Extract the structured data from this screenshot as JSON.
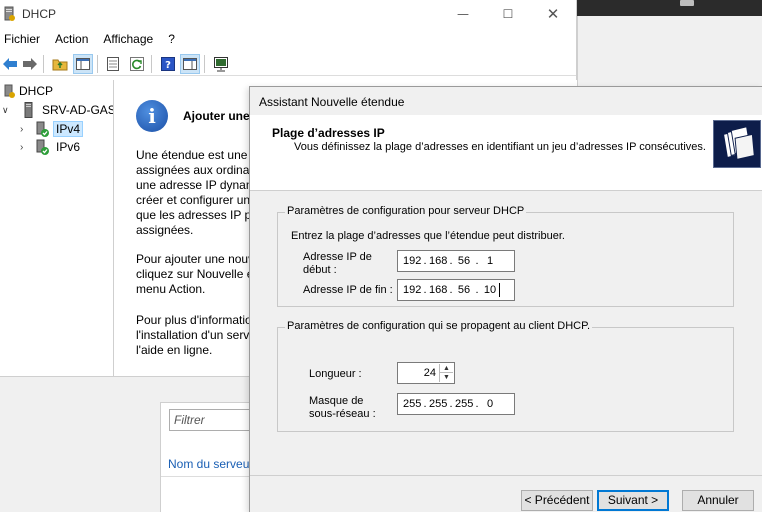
{
  "mmc": {
    "title": "DHCP",
    "menu": [
      "Fichier",
      "Action",
      "Affichage",
      "?"
    ],
    "toolbar_icons": [
      "back-arrow-icon",
      "forward-arrow-icon",
      "up-folder-icon",
      "show-hide-tree-icon",
      "properties-icon",
      "refresh-icon",
      "help-icon",
      "console-tree-icon",
      "monitor-icon"
    ]
  },
  "tree": {
    "root": "DHCP",
    "server": "SRV-AD-GASC",
    "ipv4": "IPv4",
    "ipv6": "IPv6"
  },
  "content": {
    "heading": "Ajouter une",
    "para1": "Une étendue est une p assignées aux ordinate une adresse IP dynam créer et configurer un que les adresses IP pu assignées.",
    "para1_lines": [
      "Une étendue est une p",
      "assignées aux ordinate",
      "une adresse IP dynam",
      "créer et configurer un",
      "que les adresses IP pu",
      "assignées."
    ],
    "para2_lines": [
      "Pour ajouter une nouv",
      "cliquez sur Nouvelle é",
      "menu Action."
    ],
    "para3_lines": [
      "Pour plus d'informatio",
      "l'installation d'un serv",
      "l'aide en ligne."
    ]
  },
  "lower": {
    "filter_placeholder": "Filtrer",
    "server_name_header": "Nom du serveur"
  },
  "wizard": {
    "title": "Assistant Nouvelle étendue",
    "header_title": "Plage d’adresses IP",
    "header_subtitle": "Vous définissez la plage d’adresses en identifiant un jeu d’adresses IP consécutives.",
    "group1_title": "Paramètres de configuration pour serveur DHCP",
    "group1_intro": "Entrez la plage d’adresses que l’étendue peut distribuer.",
    "start_label_l1": "Adresse IP de",
    "start_label_l2": "début :",
    "start_ip": [
      "192",
      "168",
      "56",
      "1"
    ],
    "end_label": "Adresse IP de fin :",
    "end_ip": [
      "192",
      "168",
      "56",
      "10"
    ],
    "group2_title": "Paramètres de configuration qui se propagent au client DHCP.",
    "length_label": "Longueur :",
    "length_value": "24",
    "mask_label_l1": "Masque de",
    "mask_label_l2": "sous-réseau :",
    "mask": [
      "255",
      "255",
      "255",
      "0"
    ],
    "btn_prev": "< Précédent",
    "btn_next": "Suivant >",
    "btn_cancel": "Annuler"
  }
}
